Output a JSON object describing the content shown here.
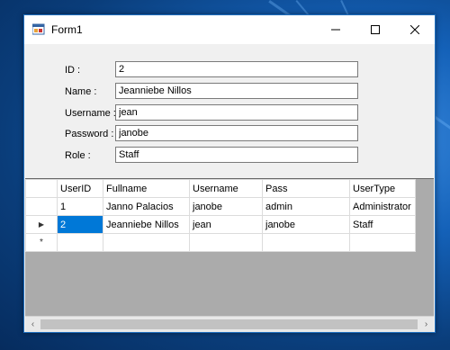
{
  "window": {
    "title": "Form1",
    "minimize_icon": "minimize-icon",
    "maximize_icon": "maximize-icon",
    "close_icon": "close-icon"
  },
  "form": {
    "id_label": "ID :",
    "id_value": "2",
    "name_label": "Name :",
    "name_value": "Jeanniebe Nillos",
    "username_label": "Username :",
    "username_value": "jean",
    "password_label": "Password :",
    "password_value": "janobe",
    "role_label": "Role :",
    "role_value": "Staff"
  },
  "grid": {
    "columns": [
      "UserID",
      "Fullname",
      "Username",
      "Pass",
      "UserType"
    ],
    "rows": [
      [
        "1",
        "Janno Palacios",
        "janobe",
        "admin",
        "Administrator"
      ],
      [
        "2",
        "Jeanniebe Nillos",
        "jean",
        "janobe",
        "Staff"
      ]
    ],
    "current_row_marker": "▶",
    "new_row_marker": "*",
    "selected_row": 1,
    "selection_color": "#0078d7"
  },
  "scrollbar": {
    "left_arrow": "‹",
    "right_arrow": "›"
  }
}
